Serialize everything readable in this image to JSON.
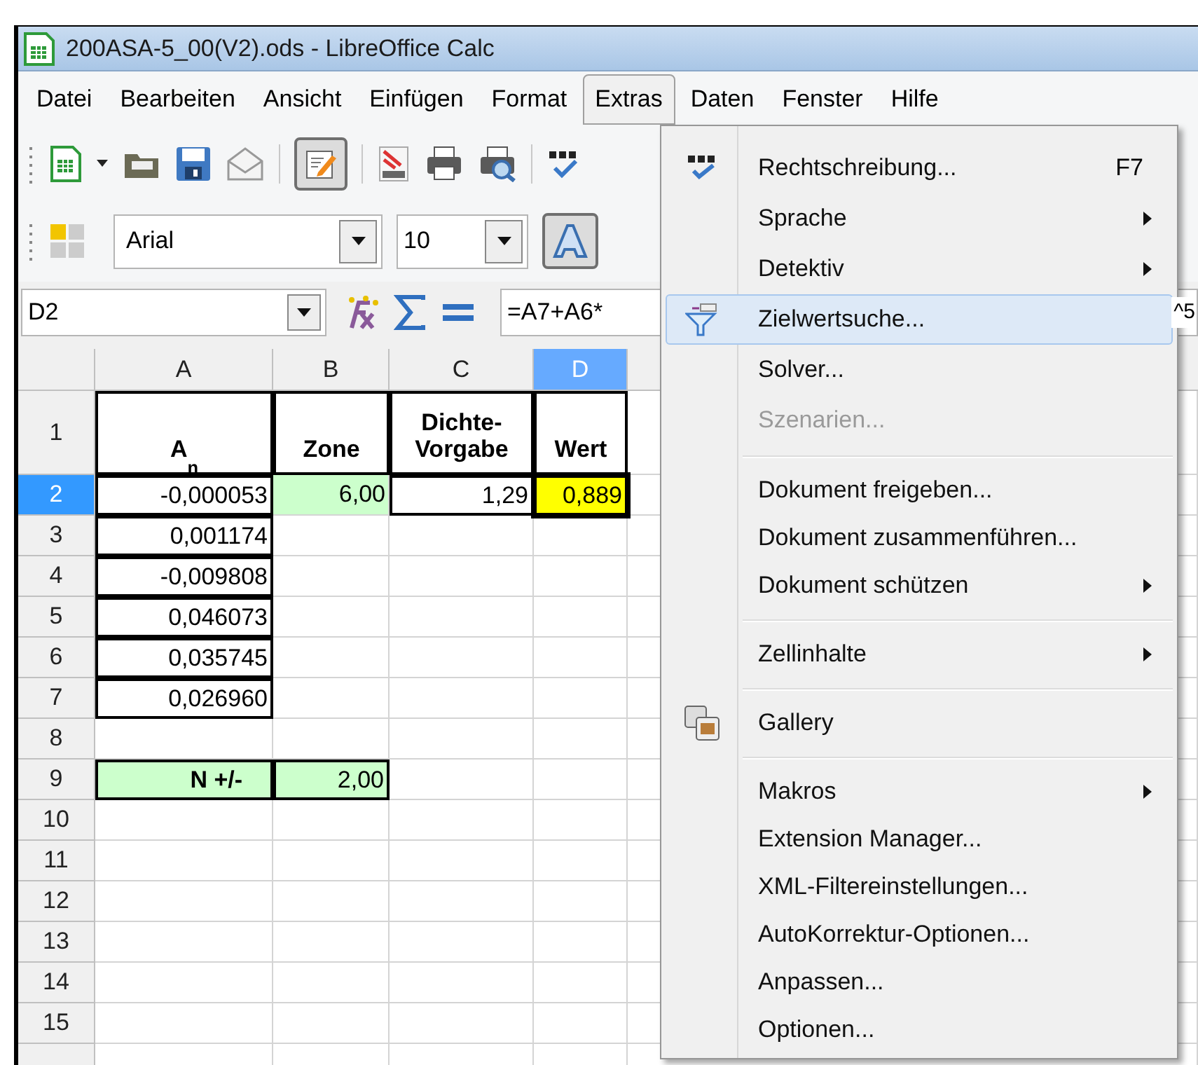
{
  "window": {
    "title": "200ASA-5_00(V2).ods - LibreOffice Calc"
  },
  "menu_bar": [
    {
      "label": "Datei",
      "selected": false
    },
    {
      "label": "Bearbeiten",
      "selected": false
    },
    {
      "label": "Ansicht",
      "selected": false
    },
    {
      "label": "Einfügen",
      "selected": false
    },
    {
      "label": "Format",
      "selected": false
    },
    {
      "label": "Extras",
      "selected": true
    },
    {
      "label": "Daten",
      "selected": false
    },
    {
      "label": "Fenster",
      "selected": false
    },
    {
      "label": "Hilfe",
      "selected": false
    }
  ],
  "formatting_toolbar": {
    "font_name": "Arial",
    "font_size": "10"
  },
  "formula_bar": {
    "name_box": "D2",
    "formula": "=A7+A6*",
    "formula_tail": "^5"
  },
  "sheet": {
    "columns": [
      {
        "label": "A",
        "selected": false
      },
      {
        "label": "B",
        "selected": false
      },
      {
        "label": "C",
        "selected": false
      },
      {
        "label": "D",
        "selected": true
      }
    ],
    "rows": [
      {
        "label": "1",
        "selected": false,
        "cells": [
          {
            "text": "A$_{n}$",
            "kind": "header",
            "border": true
          },
          {
            "text": "Zone",
            "kind": "header",
            "border": true
          },
          {
            "text": "Dichte-\nVorgabe",
            "kind": "header",
            "border": true
          },
          {
            "text": "Wert",
            "kind": "header",
            "border": true
          }
        ]
      },
      {
        "label": "2",
        "selected": true,
        "cells": [
          {
            "text": "-0,000053",
            "kind": "number",
            "border": true
          },
          {
            "text": "6,00",
            "kind": "number",
            "color": "#ccffcc"
          },
          {
            "text": "1,29",
            "kind": "number",
            "border": true
          },
          {
            "text": "0,889",
            "kind": "number",
            "color": "#ffff00",
            "border": true,
            "selected": true
          }
        ]
      },
      {
        "label": "3",
        "selected": false,
        "cells": [
          {
            "text": "0,001174",
            "kind": "number",
            "border": true
          }
        ]
      },
      {
        "label": "4",
        "selected": false,
        "cells": [
          {
            "text": "-0,009808",
            "kind": "number",
            "border": true
          }
        ]
      },
      {
        "label": "5",
        "selected": false,
        "cells": [
          {
            "text": "0,046073",
            "kind": "number",
            "border": true
          }
        ]
      },
      {
        "label": "6",
        "selected": false,
        "cells": [
          {
            "text": "0,035745",
            "kind": "number",
            "border": true
          }
        ]
      },
      {
        "label": "7",
        "selected": false,
        "cells": [
          {
            "text": "0,026960",
            "kind": "number",
            "border": true
          }
        ]
      },
      {
        "label": "8",
        "selected": false,
        "cells": []
      },
      {
        "label": "9",
        "selected": false,
        "cells": [
          {
            "text": "N +/-",
            "kind": "label",
            "color": "#ccffcc",
            "border": true
          },
          {
            "text": "2,00",
            "kind": "number",
            "color": "#ccffcc",
            "border": true
          }
        ]
      },
      {
        "label": "10",
        "selected": false,
        "cells": []
      },
      {
        "label": "11",
        "selected": false,
        "cells": []
      },
      {
        "label": "12",
        "selected": false,
        "cells": []
      },
      {
        "label": "13",
        "selected": false,
        "cells": []
      },
      {
        "label": "14",
        "selected": false,
        "cells": []
      },
      {
        "label": "15",
        "selected": false,
        "cells": []
      }
    ]
  },
  "extras_menu": [
    {
      "kind": "item",
      "label": "Rechtschreibung...",
      "shortcut": "F7",
      "submenu": false,
      "disabled": false,
      "selected": false
    },
    {
      "kind": "item",
      "label": "Sprache",
      "submenu": true,
      "disabled": false,
      "selected": false
    },
    {
      "kind": "item",
      "label": "Detektiv",
      "submenu": true,
      "disabled": false,
      "selected": false
    },
    {
      "kind": "item",
      "label": "Zielwertsuche...",
      "submenu": false,
      "disabled": false,
      "selected": true
    },
    {
      "kind": "item",
      "label": "Solver...",
      "submenu": false,
      "disabled": false,
      "selected": false
    },
    {
      "kind": "item",
      "label": "Szenarien...",
      "submenu": false,
      "disabled": true,
      "selected": false
    },
    {
      "kind": "separator"
    },
    {
      "kind": "item",
      "label": "Dokument freigeben...",
      "submenu": false,
      "disabled": false,
      "selected": false
    },
    {
      "kind": "item",
      "label": "Dokument zusammenführen...",
      "submenu": false,
      "disabled": false,
      "selected": false
    },
    {
      "kind": "item",
      "label": "Dokument schützen",
      "submenu": true,
      "disabled": false,
      "selected": false
    },
    {
      "kind": "separator"
    },
    {
      "kind": "item",
      "label": "Zellinhalte",
      "submenu": true,
      "disabled": false,
      "selected": false
    },
    {
      "kind": "separator"
    },
    {
      "kind": "item",
      "label": "Gallery",
      "submenu": false,
      "disabled": false,
      "selected": false
    },
    {
      "kind": "separator"
    },
    {
      "kind": "item",
      "label": "Makros",
      "submenu": true,
      "disabled": false,
      "selected": false
    },
    {
      "kind": "item",
      "label": "Extension Manager...",
      "submenu": false,
      "disabled": false,
      "selected": false
    },
    {
      "kind": "item",
      "label": "XML-Filtereinstellungen...",
      "submenu": false,
      "disabled": false,
      "selected": false
    },
    {
      "kind": "item",
      "label": "AutoKorrektur-Optionen...",
      "submenu": false,
      "disabled": false,
      "selected": false
    },
    {
      "kind": "item",
      "label": "Anpassen...",
      "submenu": false,
      "disabled": false,
      "selected": false
    },
    {
      "kind": "item",
      "label": "Optionen...",
      "submenu": false,
      "disabled": false,
      "selected": false
    }
  ]
}
